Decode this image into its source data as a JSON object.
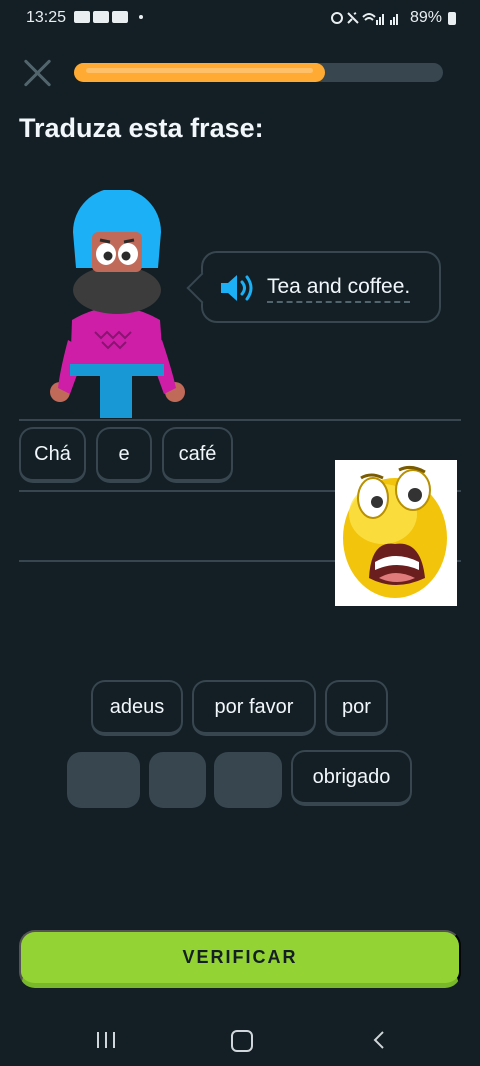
{
  "status_bar": {
    "time": "13:25",
    "battery": "89%"
  },
  "progress": {
    "fraction": 0.68
  },
  "title": "Traduza esta frase:",
  "prompt": {
    "sentence": "Tea and coffee."
  },
  "answer_tiles": [
    "Chá",
    "e",
    "café"
  ],
  "word_bank": {
    "row1": [
      "adeus",
      "por favor",
      "por"
    ],
    "row2_last": "obrigado"
  },
  "verify_button": "VERIFICAR",
  "colors": {
    "background": "#131f24",
    "progress": "#ffab33",
    "button": "#93d334",
    "speaker": "#1cb0f6"
  }
}
